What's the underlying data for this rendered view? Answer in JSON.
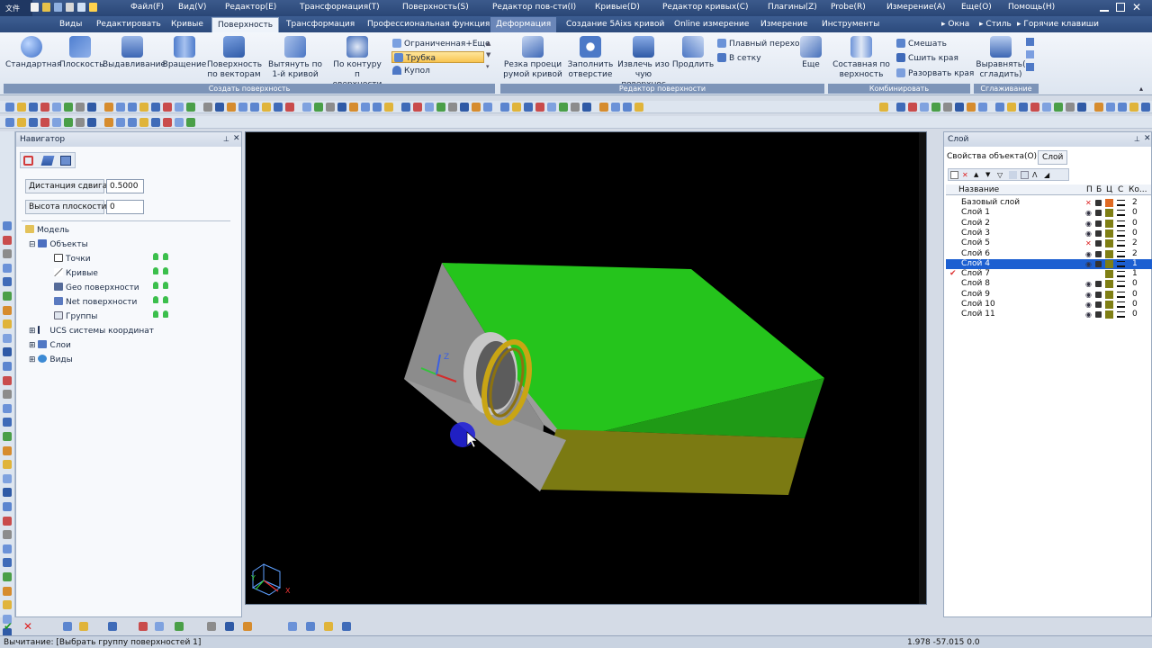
{
  "menu": {
    "file_badge": "文件",
    "items": [
      "Файл(F)",
      "Вид(V)",
      "Редактор(E)",
      "Трансформация(T)",
      "Поверхность(S)",
      "Редактор пов-сти(I)",
      "Кривые(D)",
      "Редактор кривых(C)",
      "Плагины(Z)",
      "Probe(R)",
      "Измерение(A)",
      "Еще(O)",
      "Помощь(H)"
    ]
  },
  "tabs": [
    "Виды",
    "Редактировать",
    "Кривые",
    "Поверхность",
    "Трансформация",
    "Профессиональная функция",
    "Деформация",
    "Создание 5Aixs кривой",
    "Online измерение",
    "Измерение",
    "Инструменты"
  ],
  "tabs_right": {
    "windows": "Окна",
    "style": "Стиль",
    "hotkeys": "Горячие клавиши"
  },
  "ribbon": {
    "create": [
      "Стандартная",
      "Плоскость",
      "Выдавливание",
      "Вращение",
      "Поверхность\nпо векторам",
      "Вытянуть по\n1-й кривой",
      "По контуру п\nоверхности"
    ],
    "create_small": [
      "Ограниченная",
      "Еще",
      "Трубка",
      "Купол"
    ],
    "create_group": "Создать поверхность",
    "edit": [
      "Резка проеци\nрумой кривой",
      "Заполнить\nотверстие",
      "Извлечь изо\nчую поверхнос",
      "Продлить"
    ],
    "edit_small": [
      "Плавный переход",
      "В сетку"
    ],
    "edit_more": "Еще",
    "edit_group": "Редактор поверхности",
    "combine": [
      "Составная по\nверхность"
    ],
    "combine_small": [
      "Смешать",
      "Сшить края",
      "Разорвать края"
    ],
    "combine_group": "Комбинировать",
    "smooth": [
      "Выравнять(\nсгладить)"
    ],
    "smooth_group": "Сглаживание"
  },
  "navigator": {
    "title": "Навигатор",
    "shift_label": "Дистанция сдвига",
    "shift_value": "0.5000",
    "plane_label": "Высота плоскости",
    "plane_value": "0",
    "tree": [
      "Модель",
      "Объекты",
      "Точки",
      "Кривые",
      "Geo поверхности",
      "Net поверхности",
      "Группы",
      "UCS системы координат",
      "Слои",
      "Виды"
    ]
  },
  "viewport": {
    "axis_z": "Z",
    "axis_y": "Y",
    "axis_x": "X"
  },
  "layers": {
    "title": "Слой",
    "tab1": "Свойства объекта(O)",
    "tab2": "Слой",
    "cols": {
      "name": "Название",
      "p": "П",
      "b": "Б",
      "c": "Ц",
      "s": "С",
      "count": "Ко..."
    },
    "rows": [
      {
        "name": "Базовый слой",
        "count": "2"
      },
      {
        "name": "Слой 1",
        "count": "0"
      },
      {
        "name": "Слой 2",
        "count": "0"
      },
      {
        "name": "Слой 3",
        "count": "0"
      },
      {
        "name": "Слой 5",
        "count": "2"
      },
      {
        "name": "Слой 6",
        "count": "2"
      },
      {
        "name": "Слой 4",
        "count": "1"
      },
      {
        "name": "Слой 7",
        "count": "1"
      },
      {
        "name": "Слой 8",
        "count": "0"
      },
      {
        "name": "Слой 9",
        "count": "0"
      },
      {
        "name": "Слой 10",
        "count": "0"
      },
      {
        "name": "Слой 11",
        "count": "0"
      }
    ]
  },
  "status": {
    "text": "Вычитание: [Выбрать группу поверхностей 1]",
    "coords": "1.978 -57.015 0.0"
  },
  "colors": {
    "accent": "#2c4a7c",
    "selection": "#1c5fd1",
    "green": "#22c21a",
    "olive": "#7f7f14",
    "gray": "#9a9a9a"
  }
}
